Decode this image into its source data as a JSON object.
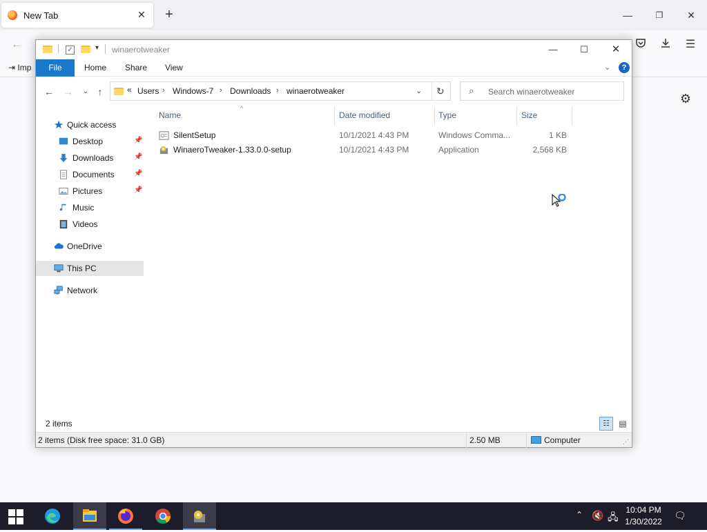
{
  "firefox": {
    "tab_title": "New Tab",
    "tab_close": "✕",
    "new_tab": "+",
    "import_label": "Imp"
  },
  "explorer": {
    "title": "winaerotweaker",
    "ribbon": {
      "file": "File",
      "home": "Home",
      "share": "Share",
      "view": "View",
      "help": "?"
    },
    "address": {
      "overflow": "«",
      "crumbs": [
        "Users",
        "Windows-7",
        "Downloads",
        "winaerotweaker"
      ],
      "separator": "›"
    },
    "search_placeholder": "Search winaerotweaker",
    "nav_pane": {
      "quick_access": "Quick access",
      "desktop": "Desktop",
      "downloads": "Downloads",
      "documents": "Documents",
      "pictures": "Pictures",
      "music": "Music",
      "videos": "Videos",
      "onedrive": "OneDrive",
      "this_pc": "This PC",
      "network": "Network"
    },
    "columns": {
      "name": "Name",
      "date": "Date modified",
      "type": "Type",
      "size": "Size"
    },
    "files": [
      {
        "name": "SilentSetup",
        "date": "10/1/2021 4:43 PM",
        "type": "Windows Comma...",
        "size": "1 KB",
        "icon": "batch-file-icon"
      },
      {
        "name": "WinaeroTweaker-1.33.0.0-setup",
        "date": "10/1/2021 4:43 PM",
        "type": "Application",
        "size": "2,568 KB",
        "icon": "installer-icon"
      }
    ],
    "item_count": "2 items",
    "status_left": "2 items (Disk free space: 31.0 GB)",
    "status_size": "2.50 MB",
    "status_location": "Computer"
  },
  "taskbar": {
    "clock_time": "10:04 PM",
    "clock_date": "1/30/2022"
  },
  "colors": {
    "file_tab": "#1979ca",
    "taskbar": "#1c1c2b",
    "selection": "#e5e5e5"
  }
}
